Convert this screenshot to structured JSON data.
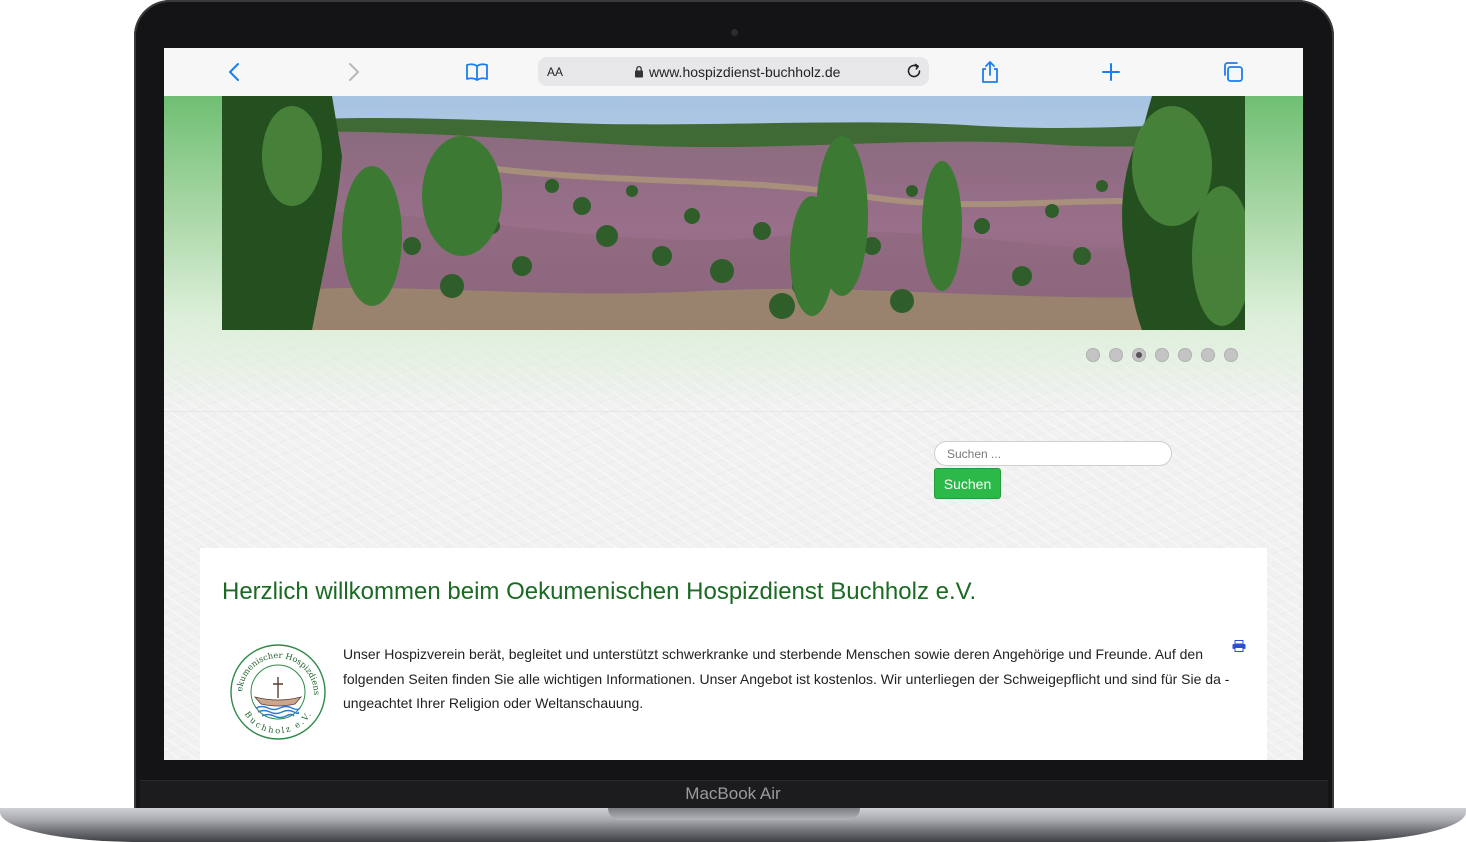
{
  "device": {
    "model_label": "MacBook Air"
  },
  "browser": {
    "text_size_label": "AA",
    "url": "www.hospizdienst-buchholz.de",
    "icons": {
      "back": "chevron-left-icon",
      "forward": "chevron-right-icon",
      "bookmarks": "book-icon",
      "lock": "lock-icon",
      "reload": "reload-icon",
      "share": "share-icon",
      "new_tab": "plus-icon",
      "tabs": "tabs-icon"
    },
    "accent_color": "#1a7ef2"
  },
  "slider": {
    "dot_count": 7,
    "active_index": 2
  },
  "search": {
    "placeholder": "Suchen ...",
    "button_label": "Suchen"
  },
  "article": {
    "title": "Herzlich willkommen beim Oekumenischen Hospizdienst Buchholz e.V.",
    "body": "Unser Hospizverein berät, begleitet und unterstützt schwerkranke und sterbende Menschen sowie deren Angehörige und Freunde. Auf den folgenden Seiten finden Sie alle wichtigen Informationen. Unser Angebot ist kostenlos. Wir unterliegen der Schweigepflicht und sind für Sie da - ungeachtet Ihrer Religion oder Weltanschauung.",
    "logo_text_top": "Oekumenischer Hospizdienst",
    "logo_text_bottom": "Buchholz e.V."
  },
  "colors": {
    "title_green": "#1b6a23",
    "button_green": "#2db84a",
    "header_green": "#6fbf73"
  }
}
